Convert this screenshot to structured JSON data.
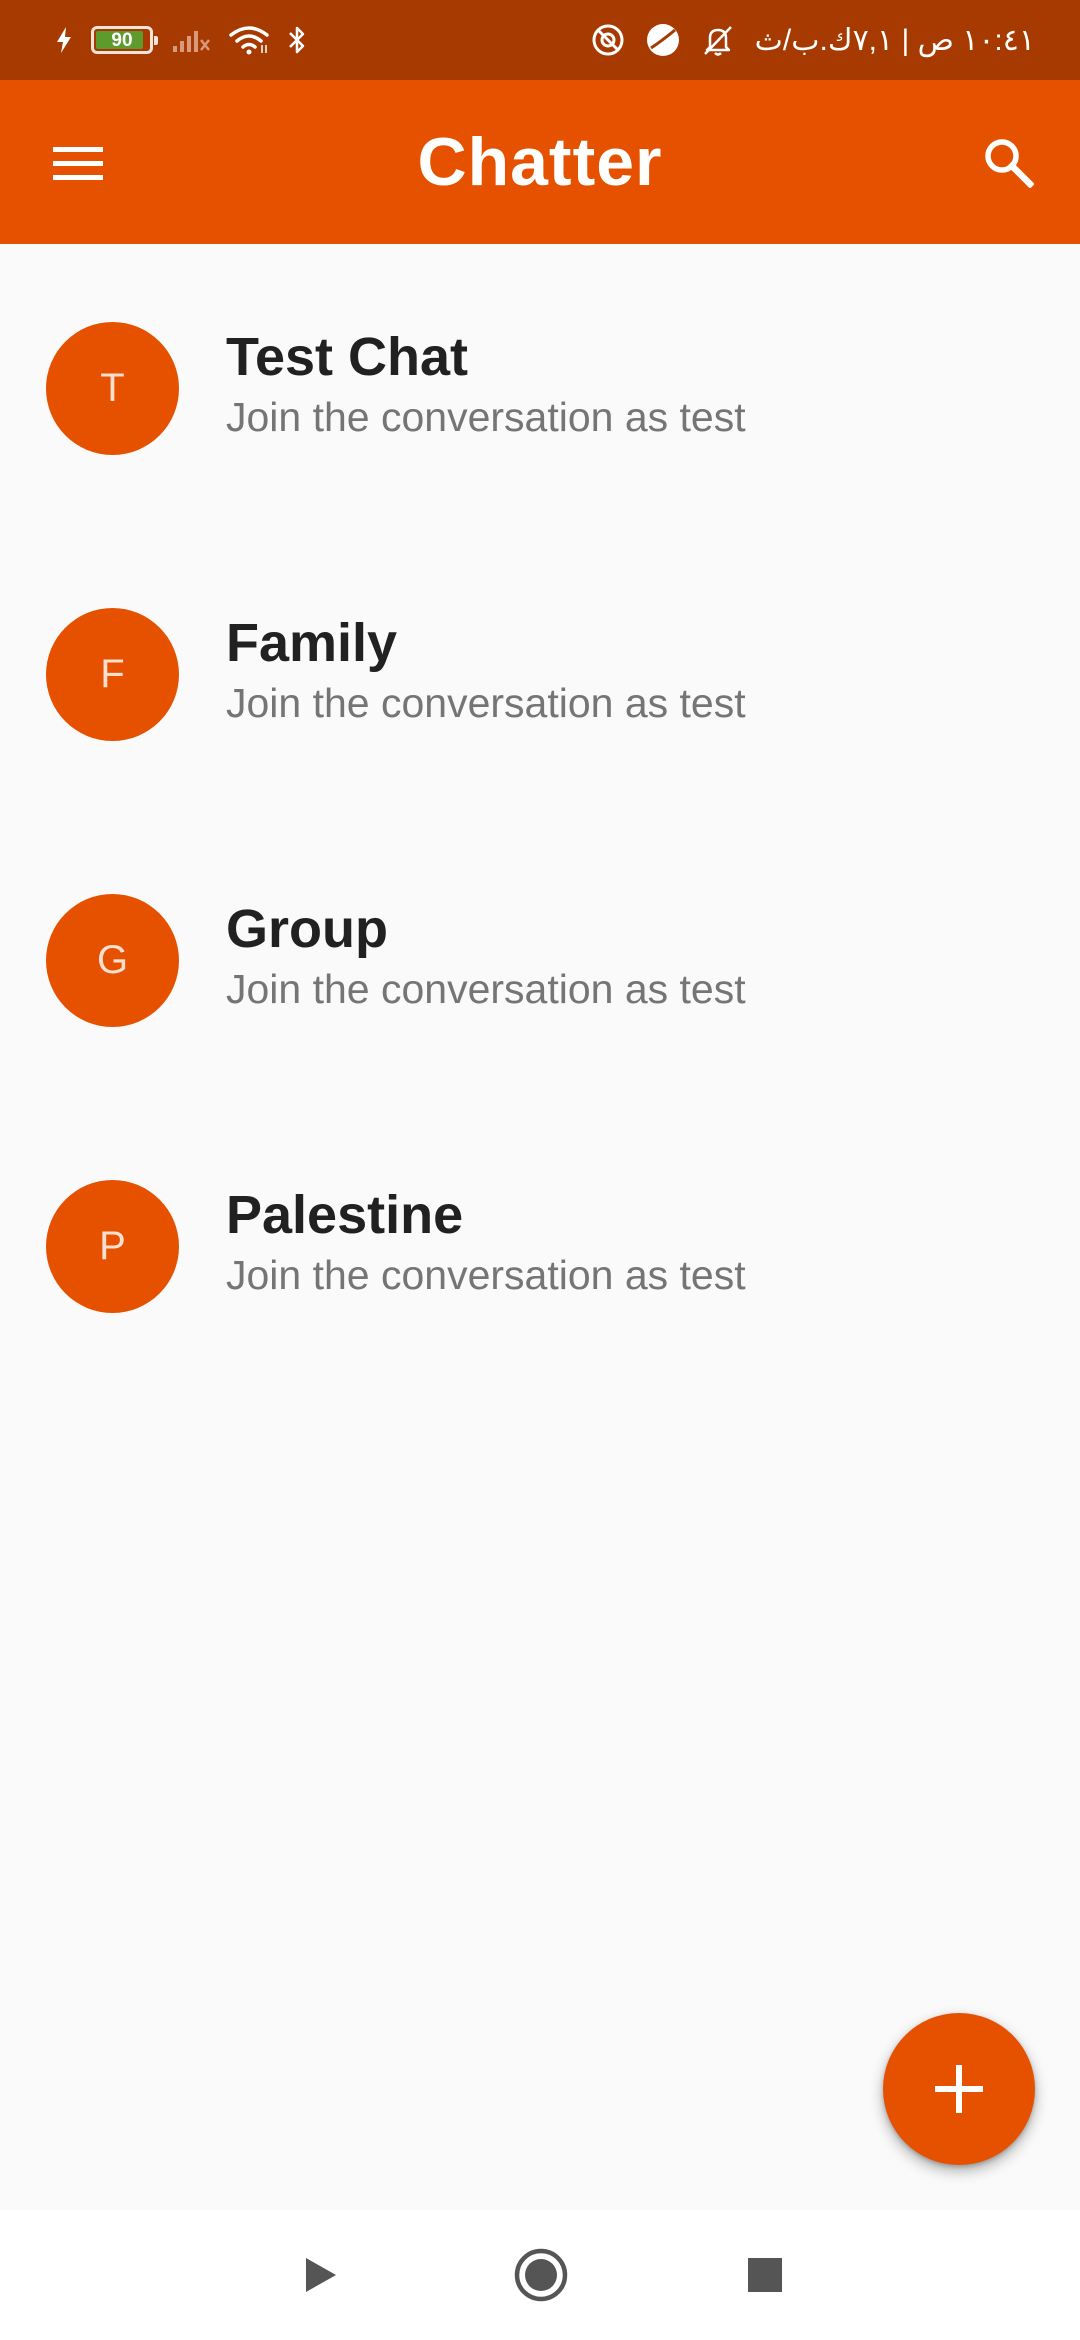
{
  "status_bar": {
    "time_text": "١٠:٤١ ص | ٧,١ك.ب/ث",
    "battery_level": "90",
    "battery_fraction": 0.9,
    "icons_left": [
      "charging-icon",
      "battery-icon",
      "signal-icon",
      "wifi-icon",
      "bluetooth-icon"
    ],
    "icons_right": [
      "do-not-disturb-icon",
      "app-notification-icon",
      "notifications-off-icon"
    ]
  },
  "app_bar": {
    "title": "Chatter",
    "menu_icon": "hamburger-menu-icon",
    "search_icon": "search-icon"
  },
  "chats": [
    {
      "initial": "T",
      "title": "Test Chat",
      "subtitle": "Join the conversation as test"
    },
    {
      "initial": "F",
      "title": "Family",
      "subtitle": "Join the conversation as test"
    },
    {
      "initial": "G",
      "title": "Group",
      "subtitle": "Join the conversation as test"
    },
    {
      "initial": "P",
      "title": "Palestine",
      "subtitle": "Join the conversation as test"
    }
  ],
  "fab": {
    "icon": "plus-icon"
  },
  "nav_bar": {
    "icons": [
      "back-triangle-icon",
      "home-circle-icon",
      "recents-square-icon"
    ]
  },
  "colors": {
    "status_bar": "#a63a00",
    "accent": "#e65100",
    "background": "#fafafa",
    "title_text": "#212121",
    "subtitle_text": "#757575"
  }
}
